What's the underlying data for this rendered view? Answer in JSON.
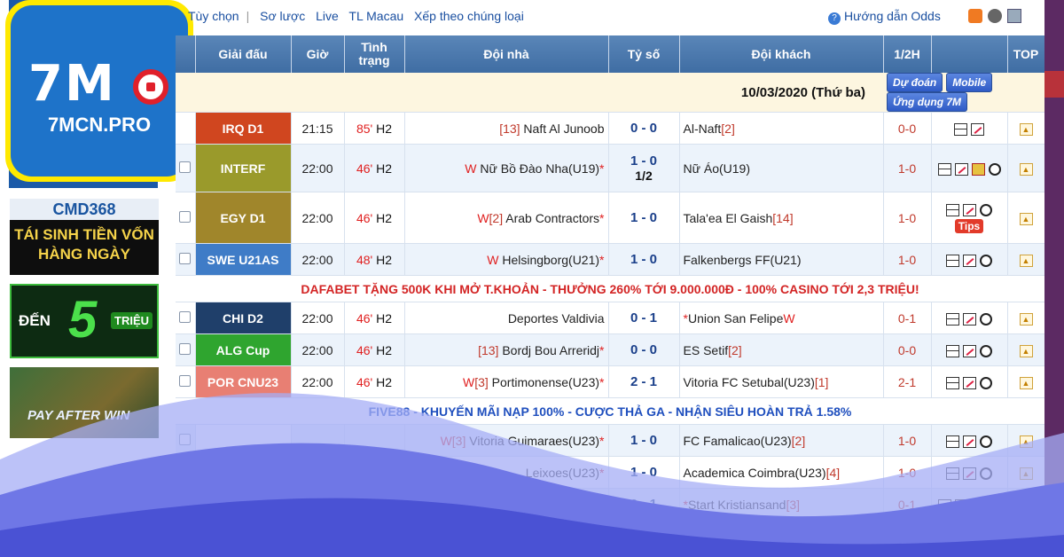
{
  "logo": {
    "mark": "7M",
    "domain": "7MCN.PRO"
  },
  "left_ads": {
    "cmd_brand": "CMD368",
    "cmd_line1": "TÁI SINH TIỀN VỐN",
    "cmd_line2": "HÀNG NGÀY",
    "five_a": "ĐẾN",
    "five_b": "5",
    "five_c": "TRIỆU",
    "pay_text": "PAY AFTER WIN"
  },
  "toplinks": [
    "Tùy chọn",
    "Sơ lược",
    "Live",
    "TL Macau",
    "Xếp theo chúng loại"
  ],
  "help_text": "Hướng dẫn Odds",
  "headers": [
    "Giải đấu",
    "Giờ",
    "Tình trạng",
    "Đội nhà",
    "Tỷ số",
    "Đội khách",
    "1/2H",
    "",
    "TOP"
  ],
  "date_row": {
    "date": "10/03/2020 (Thứ ba)",
    "btn_predict": "Dự đoán",
    "btn_mobile": "Mobile",
    "btn_app": "Ứng dụng 7M"
  },
  "promo1": "DAFABET TẶNG 500K KHI MỞ T.KHOẢN - THƯỞNG 260% TỚI 9.000.000Đ - 100% CASINO TỚI 2,3 TRIỆU!",
  "promo2": "FIVE88 - KHUYẾN MÃI NẠP 100% - CƯỢC THẢ GA - NHẬN SIÊU HOÀN TRẢ 1.58%",
  "matches_a": [
    {
      "league": "IRQ D1",
      "color": "#d0461f",
      "time": "21:15",
      "minute": "85'",
      "half": "H2",
      "home_pre": "",
      "home_rank": "[13]",
      "home": "Naft Al Junoob",
      "home_star": "",
      "score": "0 - 0",
      "score2": "",
      "away": "Al-Naft",
      "away_rank": "[2]",
      "away_post": "",
      "ht": "0-0",
      "icons": "stat,odds",
      "tips": ""
    },
    {
      "league": "INTERF",
      "color": "#9a9a2b",
      "time": "22:00",
      "minute": "46'",
      "half": "H2",
      "home_pre": "W",
      "home_rank": "",
      "home": "Nữ Bồ Đào Nha(U19)",
      "home_star": "*",
      "score": "1 - 0",
      "score2": "1/2",
      "away": "Nữ Áo(U19)",
      "away_rank": "",
      "away_post": "",
      "ht": "1-0",
      "icons": "stat,odds,card,ball",
      "tips": ""
    },
    {
      "league": "EGY D1",
      "color": "#a0862b",
      "time": "22:00",
      "minute": "46'",
      "half": "H2",
      "home_pre": "W",
      "home_rank": "[2]",
      "home": "Arab Contractors",
      "home_star": "*",
      "score": "1 - 0",
      "score2": "",
      "away": "Tala'ea El Gaish",
      "away_rank": "[14]",
      "away_post": "",
      "ht": "1-0",
      "icons": "stat,odds,ball",
      "tips": "Tips"
    },
    {
      "league": "SWE U21AS",
      "color": "#3f7cc7",
      "time": "22:00",
      "minute": "48'",
      "half": "H2",
      "home_pre": "W",
      "home_rank": "",
      "home": "Helsingborg(U21)",
      "home_star": "*",
      "score": "1 - 0",
      "score2": "",
      "away": "Falkenbergs FF(U21)",
      "away_rank": "",
      "away_post": "",
      "ht": "1-0",
      "icons": "stat,odds,ball",
      "tips": ""
    }
  ],
  "matches_b": [
    {
      "league": "CHI D2",
      "color": "#1f3f6a",
      "time": "22:00",
      "minute": "46'",
      "half": "H2",
      "home_pre": "",
      "home_rank": "",
      "home": "Deportes Valdivia",
      "home_star": "",
      "score": "0 - 1",
      "score2": "",
      "away": "Union San Felipe",
      "away_rank": "",
      "away_pre": "*",
      "away_post": "W",
      "ht": "0-1",
      "icons": "stat,odds,ball",
      "tips": ""
    },
    {
      "league": "ALG Cup",
      "color": "#2fa52f",
      "time": "22:00",
      "minute": "46'",
      "half": "H2",
      "home_pre": "",
      "home_rank": "[13]",
      "home": "Bordj Bou Arreridj",
      "home_star": "*",
      "score": "0 - 0",
      "score2": "",
      "away": "ES Setif",
      "away_rank": "[2]",
      "away_pre": "",
      "away_post": "",
      "ht": "0-0",
      "icons": "stat,odds,ball",
      "tips": ""
    },
    {
      "league": "POR CNU23",
      "color": "#e87f73",
      "time": "22:00",
      "minute": "46'",
      "half": "H2",
      "home_pre": "W",
      "home_rank": "[3]",
      "home": "Portimonense(U23)",
      "home_star": "*",
      "score": "2 - 1",
      "score2": "",
      "away": "Vitoria FC Setubal(U23)",
      "away_rank": "[1]",
      "away_pre": "",
      "away_post": "",
      "ht": "2-1",
      "icons": "stat,odds,ball",
      "tips": ""
    }
  ],
  "matches_c": [
    {
      "home_pre": "W",
      "home_rank": "[3]",
      "home": "Vitoria Guimaraes(U23)",
      "home_star": "*",
      "score": "1 - 0",
      "away": "FC Famalicao(U23)",
      "away_rank": "[2]",
      "away_pre": "",
      "ht": "1-0",
      "icons": "stat,odds,ball"
    },
    {
      "home_pre": "",
      "home_rank": "",
      "home": "Leixoes(U23)",
      "home_star": "*",
      "score": "1 - 0",
      "away": "Academica Coimbra(U23)",
      "away_rank": "[4]",
      "away_pre": "",
      "ht": "1-0",
      "icons": "stat,odds,ball"
    },
    {
      "home_pre": "",
      "home_rank": "",
      "home": "",
      "home_star": "",
      "score": "0 - 1",
      "away": "Start Kristiansand",
      "away_rank": "[3]",
      "away_pre": "*",
      "ht": "0-1",
      "icons": "stat,odds,card,ball"
    }
  ]
}
